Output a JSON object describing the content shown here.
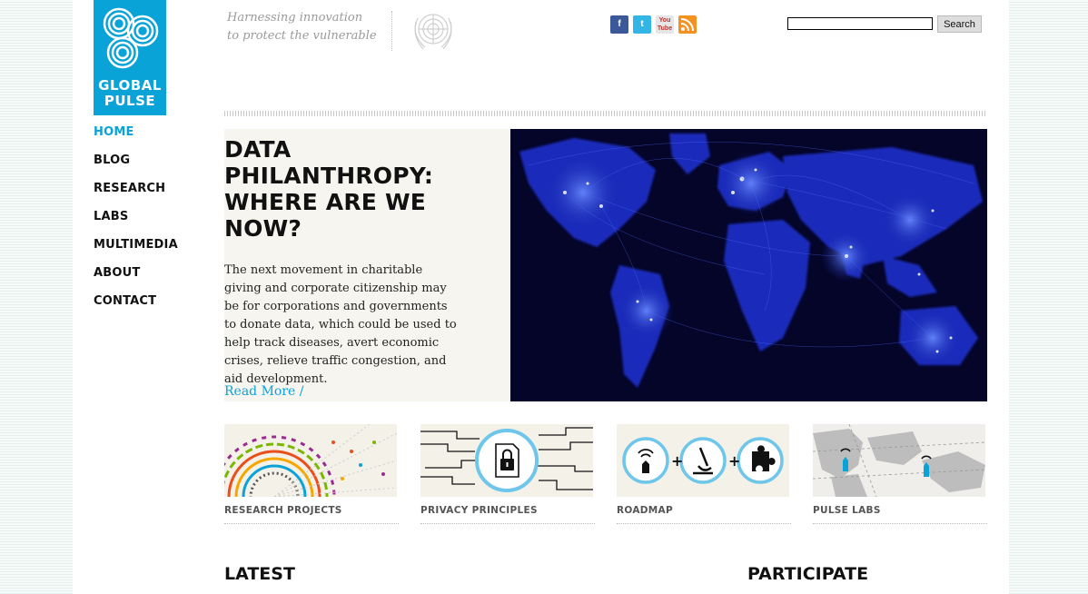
{
  "brand": {
    "logo_line1": "GLOBAL",
    "logo_line2": "PULSE",
    "accent": "#0aa3d8"
  },
  "nav": {
    "items": [
      {
        "label": "HOME",
        "active": true
      },
      {
        "label": "BLOG"
      },
      {
        "label": "RESEARCH"
      },
      {
        "label": "LABS"
      },
      {
        "label": "MULTIMEDIA"
      },
      {
        "label": "ABOUT"
      },
      {
        "label": "CONTACT"
      }
    ]
  },
  "tagline": {
    "line1": "Harnessing innovation",
    "line2": "to protect the vulnerable"
  },
  "social": {
    "facebook": "f",
    "twitter": "t",
    "youtube": "You Tube",
    "rss_icon": "rss-icon"
  },
  "search": {
    "value": "",
    "button_label": "Search"
  },
  "feature": {
    "title": "DATA PHILANTHROPY: WHERE ARE WE NOW?",
    "body": "The next movement in charitable giving and corporate citizenship may be for corporations and governments to donate data, which could be used to help track diseases, avert economic crises, relieve traffic congestion, and aid development.",
    "read_more": "Read More /"
  },
  "tiles": [
    {
      "label": "RESEARCH PROJECTS",
      "icon": "research-rings-icon"
    },
    {
      "label": "PRIVACY PRINCIPLES",
      "icon": "padlock-document-icon"
    },
    {
      "label": "ROADMAP",
      "icon": "roadmap-icons"
    },
    {
      "label": "PULSE LABS",
      "icon": "world-map-icon"
    }
  ],
  "sections": {
    "latest": "LATEST",
    "participate": "PARTICIPATE"
  }
}
